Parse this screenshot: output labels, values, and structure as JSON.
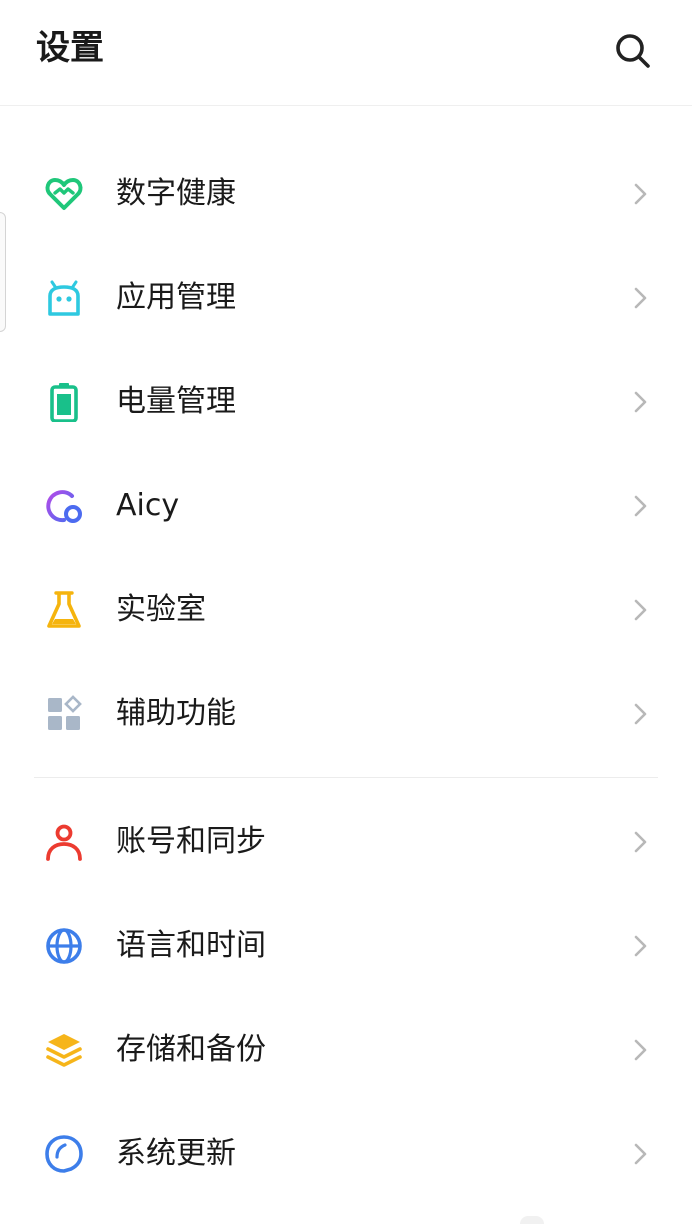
{
  "header": {
    "title": "设置",
    "search_icon": "search-icon"
  },
  "sections": [
    {
      "items": [
        {
          "label": "数字健康",
          "icon": "digital-wellbeing-heart-icon",
          "color": "#1FC77A"
        },
        {
          "label": "应用管理",
          "icon": "app-management-robot-icon",
          "color": "#2EC9E0"
        },
        {
          "label": "电量管理",
          "icon": "battery-icon",
          "color": "#19C08A"
        },
        {
          "label": "Aicy",
          "icon": "aicy-icon",
          "color": "#7B5CF0"
        },
        {
          "label": "实验室",
          "icon": "lab-flask-icon",
          "color": "#F5B40E"
        },
        {
          "label": "辅助功能",
          "icon": "accessibility-grid-icon",
          "color": "#A9B7C8"
        }
      ]
    },
    {
      "items": [
        {
          "label": "账号和同步",
          "icon": "account-person-icon",
          "color": "#EC3B30"
        },
        {
          "label": "语言和时间",
          "icon": "language-globe-icon",
          "color": "#3D7EEA"
        },
        {
          "label": "存储和备份",
          "icon": "storage-layers-icon",
          "color": "#F6B51A"
        },
        {
          "label": "系统更新",
          "icon": "system-update-icon",
          "color": "#3D7EEA"
        }
      ]
    }
  ]
}
